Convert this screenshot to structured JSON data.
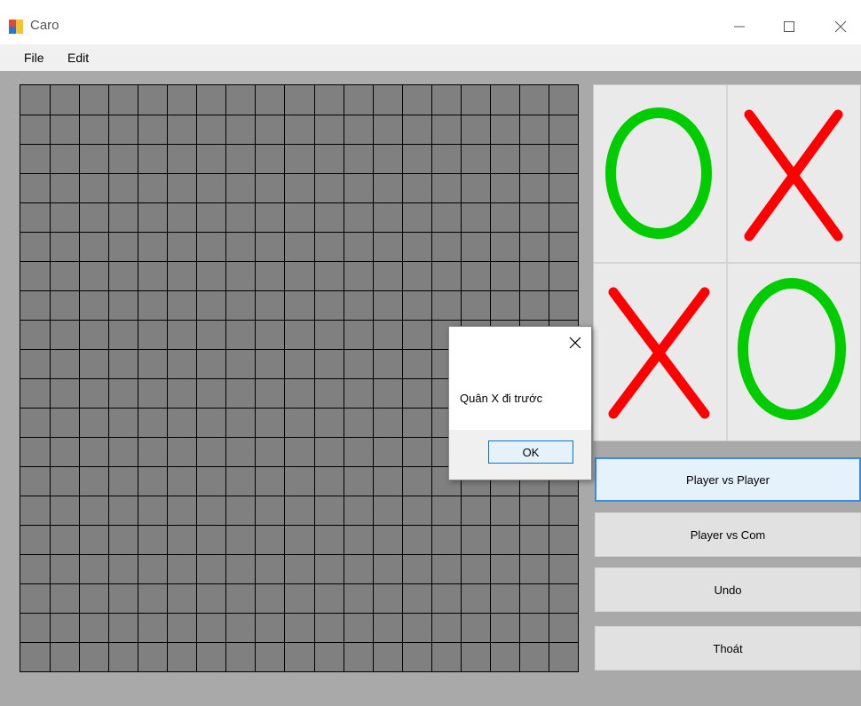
{
  "window": {
    "title": "Caro"
  },
  "menu": {
    "items": [
      "File",
      "Edit"
    ]
  },
  "board": {
    "rows": 20,
    "cols": 19,
    "cell_color": "#808080",
    "line_color": "#000000"
  },
  "logo": {
    "cells": [
      "O",
      "X",
      "X",
      "O"
    ],
    "o_color": "#00cc00",
    "x_color": "#ff0000"
  },
  "buttons": {
    "pvp": "Player vs Player",
    "pvc": "Player vs Com",
    "undo": "Undo",
    "exit": "Thoát"
  },
  "dialog": {
    "message": "Quân X đi trước",
    "ok": "OK"
  }
}
